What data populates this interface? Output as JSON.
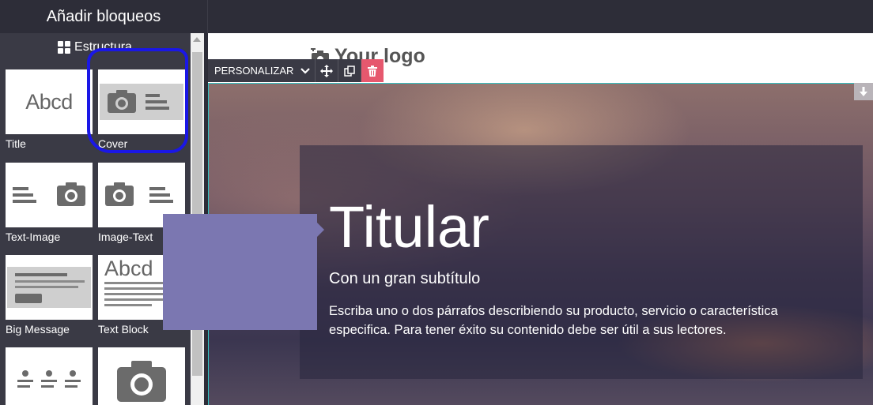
{
  "panel": {
    "title": "Añadir bloqueos",
    "section_label": "Estructura"
  },
  "blocks": [
    {
      "label": "Title",
      "icon": "abcd-text-icon",
      "thumb_text": "Abcd"
    },
    {
      "label": "Cover",
      "icon": "cover-icon"
    },
    {
      "label": "Text-Image",
      "icon": "text-image-icon"
    },
    {
      "label": "Image-Text",
      "icon": "image-text-icon"
    },
    {
      "label": "Big Message",
      "icon": "big-message-icon"
    },
    {
      "label": "Text Block",
      "icon": "text-block-icon",
      "thumb_text": "Abcd"
    },
    {
      "label": "",
      "icon": "features-icon"
    },
    {
      "label": "",
      "icon": "camera-icon"
    }
  ],
  "canvas": {
    "logo_text": "Your logo",
    "toolbar": {
      "customize_label": "PERSONALIZAR"
    },
    "cover": {
      "headline": "Titular",
      "subtitle": "Con un gran subtítulo",
      "paragraph": "Escriba uno o dos párrafos describiendo su producto, servicio o característica especifica. Para tener éxito su contenido debe ser útil a sus lectores."
    }
  },
  "colors": {
    "toolbar_bg": "#3a3a45",
    "delete_accent": "#e6586e",
    "drag_ghost": "#7b77b1",
    "annotation": "#1a17e6",
    "selection_outline": "#34c4c4"
  }
}
